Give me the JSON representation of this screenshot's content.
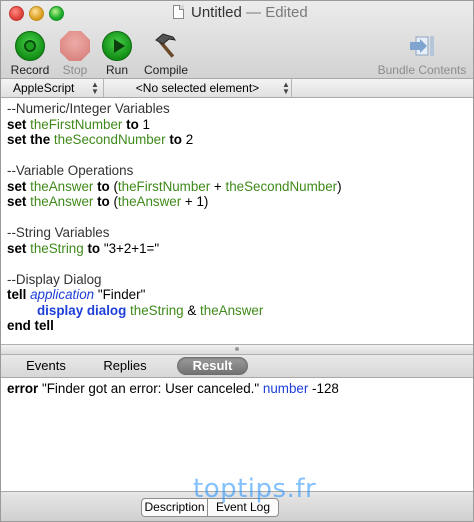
{
  "window": {
    "title": "Untitled",
    "title_status": "— Edited"
  },
  "toolbar": {
    "record_label": "Record",
    "stop_label": "Stop",
    "run_label": "Run",
    "compile_label": "Compile",
    "bundle_label": "Bundle Contents"
  },
  "navbar": {
    "language": "AppleScript",
    "element": "<No selected element>"
  },
  "script": {
    "l1": "--Numeric/Integer Variables",
    "l2_kw": "set",
    "l2_var": "theFirstNumber",
    "l2_to": "to",
    "l2_val": "1",
    "l3_kw": "set",
    "l3_the": "the",
    "l3_var": "theSecondNumber",
    "l3_to": "to",
    "l3_val": "2",
    "l5": "--Variable Operations",
    "l6_kw": "set",
    "l6_var": "theAnswer",
    "l6_to": "to",
    "l6_a": "theFirstNumber",
    "l6_b": "theSecondNumber",
    "l7_kw": "set",
    "l7_var": "theAnswer",
    "l7_to": "to",
    "l7_a": "theAnswer",
    "l7_rest": "+ 1)",
    "l9": "--String Variables",
    "l10_kw": "set",
    "l10_var": "theString",
    "l10_to": "to",
    "l10_val": "\"3+2+1=\"",
    "l12": "--Display Dialog",
    "l13_kw": "tell",
    "l13_cls": "application",
    "l13_val": "\"Finder\"",
    "l14_kw": "display dialog",
    "l14_a": "theString",
    "l14_amp": "&",
    "l14_b": "theAnswer",
    "l15_kw": "end tell"
  },
  "tabs": {
    "events": "Events",
    "replies": "Replies",
    "result": "Result"
  },
  "result": {
    "kw": "error",
    "message": "\"Finder got an error: User canceled.\"",
    "number_kw": "number",
    "number_val": "-128"
  },
  "bottombar": {
    "description": "Description",
    "event_log": "Event Log"
  },
  "watermark": "toptips.fr"
}
